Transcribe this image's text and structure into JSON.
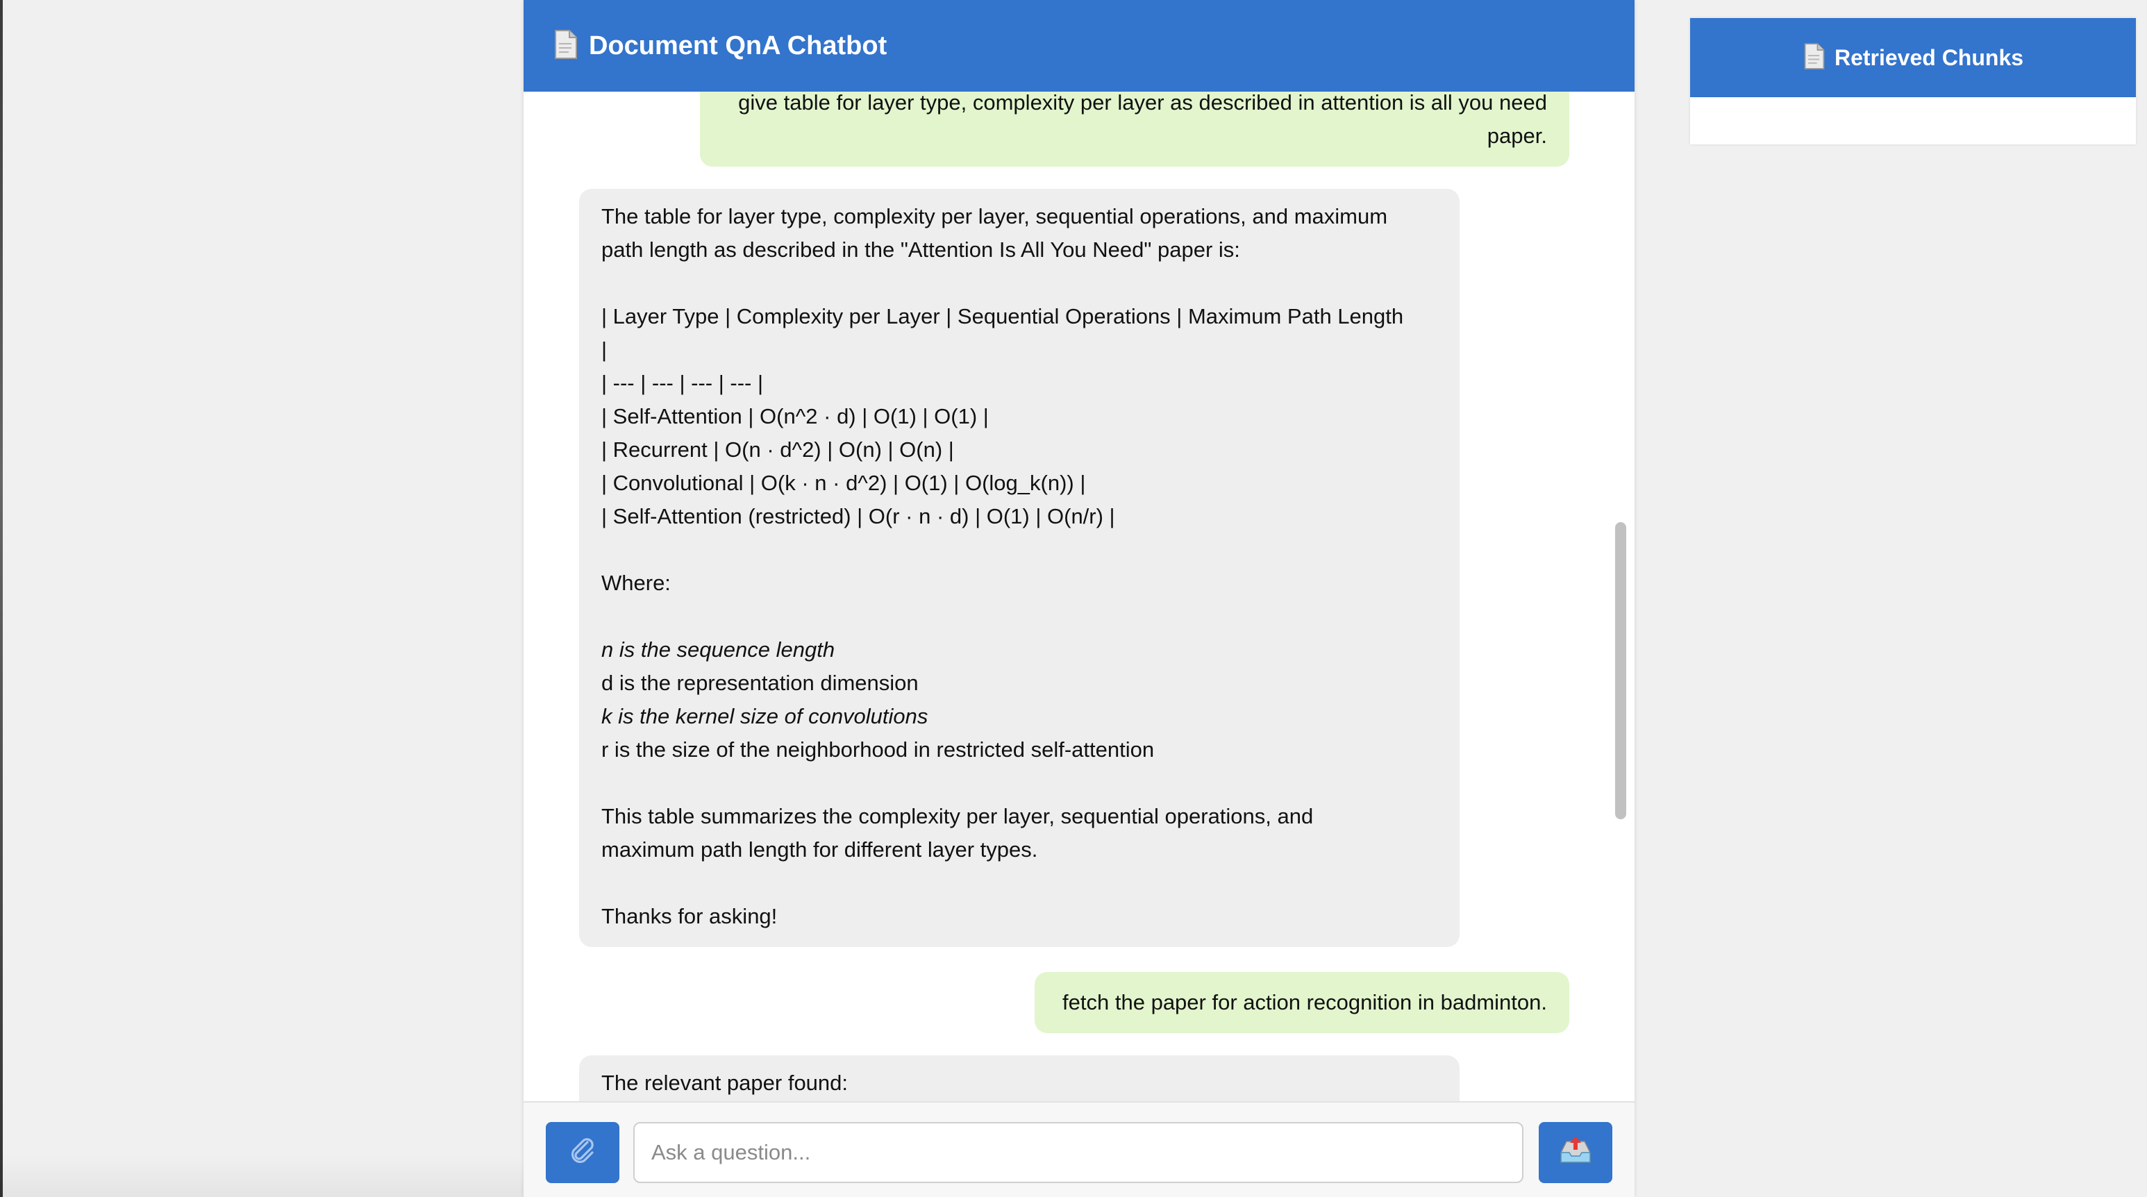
{
  "header": {
    "title": "Document QnA Chatbot",
    "icon": "document-icon"
  },
  "messages": [
    {
      "role": "user",
      "lines": [
        "give table for layer type, complexity per layer as described in attention is all you need",
        "paper."
      ]
    },
    {
      "role": "bot",
      "lines": [
        "The table for layer type, complexity per layer, sequential operations, and maximum",
        "path length as described in the \"Attention Is All You Need\" paper is:",
        "",
        "| Layer Type | Complexity per Layer | Sequential Operations | Maximum Path Length",
        "|",
        "| --- | --- | --- | --- |",
        "| Self-Attention | O(n^2 · d) | O(1) | O(1) |",
        "| Recurrent | O(n · d^2) | O(n) | O(n) |",
        "| Convolutional | O(k · n · d^2) | O(1) | O(log_k(n)) |",
        "| Self-Attention (restricted) | O(r · n · d) | O(1) | O(n/r) |",
        "",
        "Where:",
        "",
        "n is the sequence length",
        "d is the representation dimension",
        "k is the kernel size of convolutions",
        "r is the size of the neighborhood in restricted self-attention",
        "",
        "This table summarizes the complexity per layer, sequential operations, and",
        "maximum path length for different layer types.",
        "",
        "Thanks for asking!"
      ]
    },
    {
      "role": "user",
      "lines": [
        "fetch the paper for action recognition in badminton."
      ]
    },
    {
      "role": "bot",
      "lines": [
        "The relevant paper found:"
      ]
    }
  ],
  "input": {
    "placeholder": "Ask a question...",
    "value": ""
  },
  "buttons": {
    "attach_icon": "paperclip-icon",
    "send_icon": "inbox-upload-icon"
  },
  "chunks_panel": {
    "title": "Retrieved Chunks",
    "icon": "document-icon"
  },
  "colors": {
    "primary": "#3374cc",
    "user_bubble": "#e2f5cd",
    "bot_bubble": "#eeeeee"
  }
}
